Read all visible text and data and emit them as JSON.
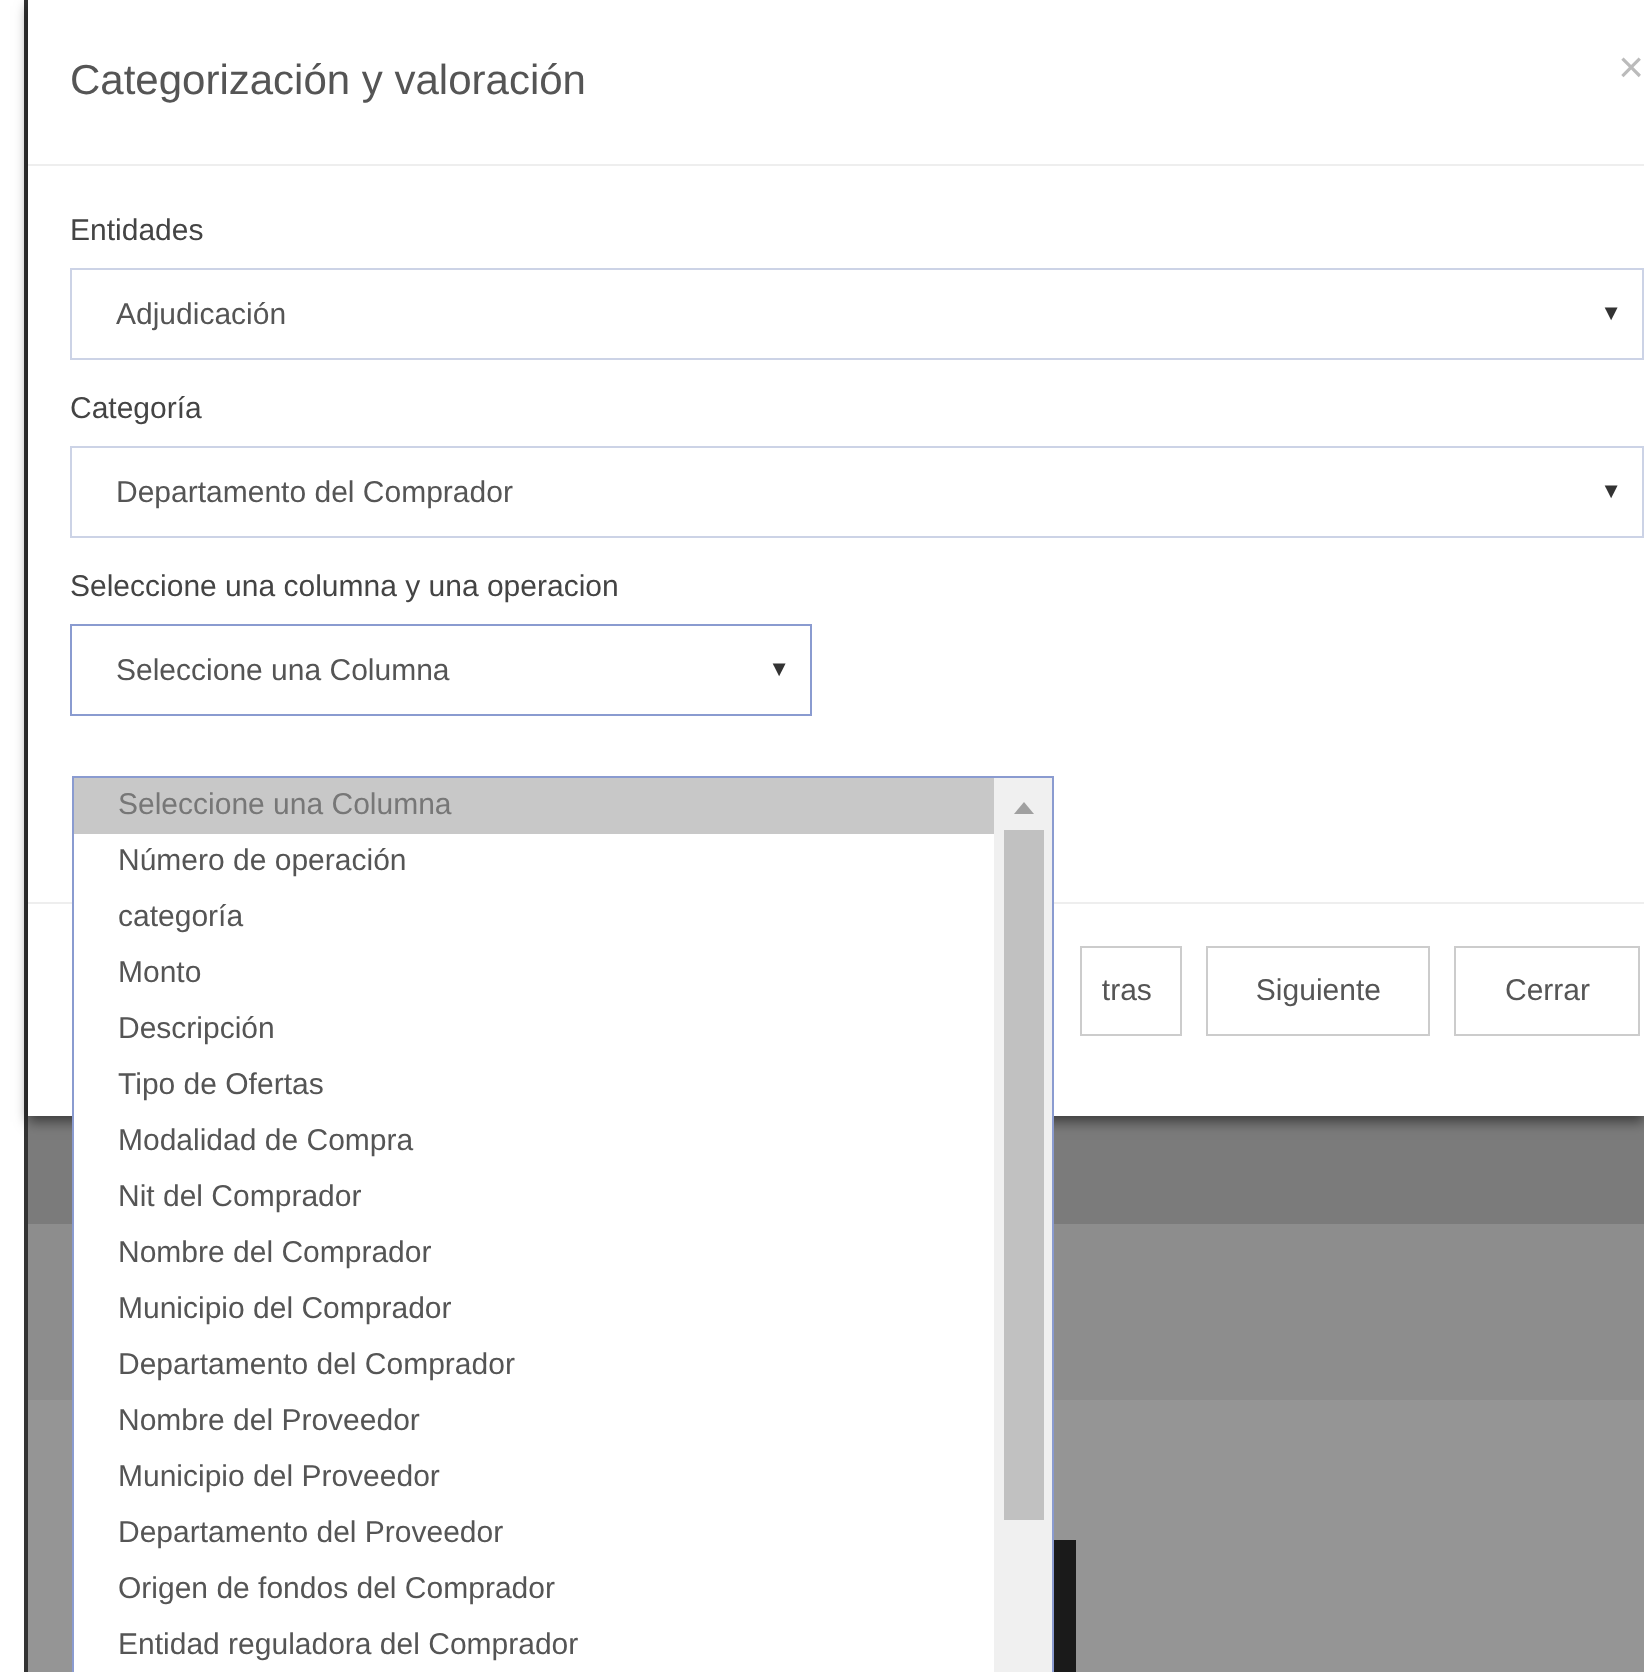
{
  "dialog": {
    "title": "Categorización y valoración",
    "close": "×"
  },
  "fields": [
    {
      "label": "Entidades",
      "value": "Adjudicación",
      "caret": "▼"
    },
    {
      "label": "Categoría",
      "value": "Departamento del Comprador",
      "caret": "▼"
    }
  ],
  "column_select": {
    "label": "Seleccione una columna y una operacion",
    "value": "Seleccione una Columna",
    "caret": "▼",
    "expanded": true
  },
  "dropdown_options": [
    {
      "label": "Seleccione una Columna",
      "selected": true
    },
    {
      "label": "Número de operación",
      "selected": false
    },
    {
      "label": "categoría",
      "selected": false
    },
    {
      "label": "Monto",
      "selected": false
    },
    {
      "label": "Descripción",
      "selected": false
    },
    {
      "label": "Tipo de Ofertas",
      "selected": false
    },
    {
      "label": "Modalidad de Compra",
      "selected": false
    },
    {
      "label": "Nit del Comprador",
      "selected": false
    },
    {
      "label": "Nombre del Comprador",
      "selected": false
    },
    {
      "label": "Municipio del Comprador",
      "selected": false
    },
    {
      "label": "Departamento del Comprador",
      "selected": false
    },
    {
      "label": "Nombre del Proveedor",
      "selected": false
    },
    {
      "label": "Municipio del Proveedor",
      "selected": false
    },
    {
      "label": "Departamento del Proveedor",
      "selected": false
    },
    {
      "label": "Origen de fondos del Comprador",
      "selected": false
    },
    {
      "label": "Entidad reguladora del Comprador",
      "selected": false
    }
  ],
  "buttons": [
    "tras",
    "Siguiente",
    "Cerrar"
  ]
}
